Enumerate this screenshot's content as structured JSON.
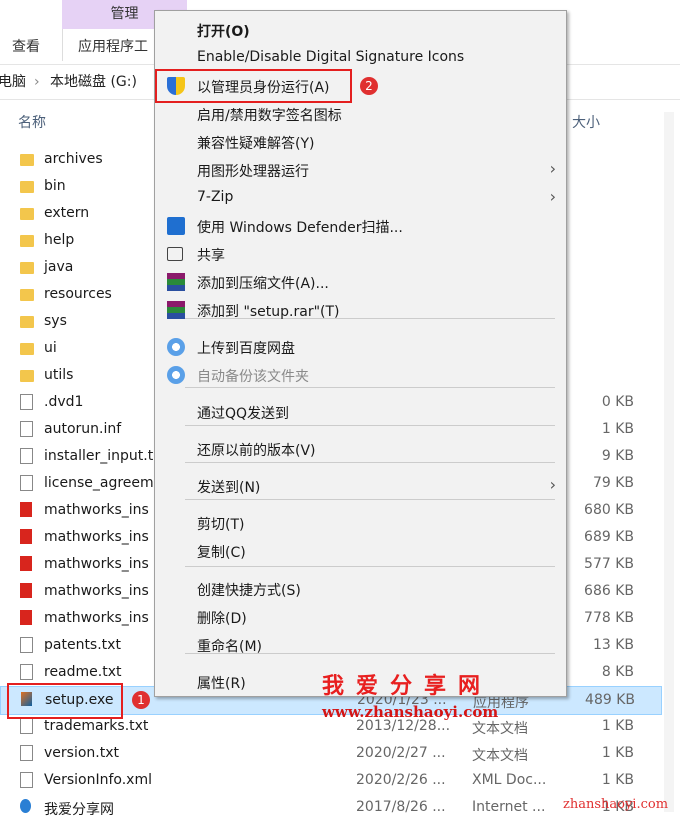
{
  "ribbon": {
    "context_tab": "管理",
    "tabs": [
      "查看",
      "应用程序工"
    ]
  },
  "address": {
    "crumbs": [
      "电脑",
      "本地磁盘 (G:)"
    ]
  },
  "columns": {
    "name": "名称",
    "size": "大小"
  },
  "files": [
    {
      "name": "archives",
      "type": "folder"
    },
    {
      "name": "bin",
      "type": "folder"
    },
    {
      "name": "extern",
      "type": "folder"
    },
    {
      "name": "help",
      "type": "folder"
    },
    {
      "name": "java",
      "type": "folder"
    },
    {
      "name": "resources",
      "type": "folder"
    },
    {
      "name": "sys",
      "type": "folder"
    },
    {
      "name": "ui",
      "type": "folder"
    },
    {
      "name": "utils",
      "type": "folder"
    },
    {
      "name": ".dvd1",
      "type": "file",
      "size": "0 KB"
    },
    {
      "name": "autorun.inf",
      "type": "file",
      "size": "1 KB"
    },
    {
      "name": "installer_input.t",
      "type": "file",
      "size": "9 KB"
    },
    {
      "name": "license_agreem",
      "type": "file",
      "size": "79 KB"
    },
    {
      "name": "mathworks_ins",
      "type": "pdf",
      "size": "680 KB"
    },
    {
      "name": "mathworks_ins",
      "type": "pdf",
      "size": "689 KB"
    },
    {
      "name": "mathworks_ins",
      "type": "pdf",
      "size": "577 KB"
    },
    {
      "name": "mathworks_ins",
      "type": "pdf",
      "size": "686 KB"
    },
    {
      "name": "mathworks_ins",
      "type": "pdf",
      "size": "778 KB"
    },
    {
      "name": "patents.txt",
      "type": "file",
      "size": "13 KB"
    },
    {
      "name": "readme.txt",
      "type": "file",
      "size": "8 KB"
    },
    {
      "name": "setup.exe",
      "type": "exe",
      "date": "2020/1/23 ...",
      "kind": "应用程序",
      "size": "489 KB",
      "selected": true
    },
    {
      "name": "trademarks.txt",
      "type": "file",
      "date": "2013/12/28...",
      "kind": "文本文档",
      "size": "1 KB"
    },
    {
      "name": "version.txt",
      "type": "file",
      "date": "2020/2/27 ...",
      "kind": "文本文档",
      "size": "1 KB"
    },
    {
      "name": "VersionInfo.xml",
      "type": "file",
      "date": "2020/2/26 ...",
      "kind": "XML Doc...",
      "size": "1 KB"
    },
    {
      "name": "我爱分享网",
      "type": "url",
      "date": "2017/8/26 ...",
      "kind": "Internet ...",
      "size": "1 KB"
    }
  ],
  "menu": [
    {
      "label": "打开(O)",
      "bold": true
    },
    {
      "label": "Enable/Disable Digital Signature Icons"
    },
    {
      "label": "以管理员身份运行(A)",
      "icon": "uac-shield-icon",
      "highlight": true
    },
    {
      "label": "启用/禁用数字签名图标"
    },
    {
      "label": "兼容性疑难解答(Y)"
    },
    {
      "label": "用图形处理器运行",
      "submenu": true
    },
    {
      "label": "7-Zip",
      "submenu": true
    },
    {
      "label": "使用 Windows Defender扫描...",
      "icon": "defender-icon"
    },
    {
      "label": "共享",
      "icon": "share-icon"
    },
    {
      "label": "添加到压缩文件(A)...",
      "icon": "winrar-icon"
    },
    {
      "label": "添加到 \"setup.rar\"(T)",
      "icon": "winrar-icon"
    },
    {
      "label": "上传到百度网盘",
      "icon": "baidu-icon"
    },
    {
      "label": "自动备份该文件夹",
      "icon": "baidu-icon",
      "disabled": true
    },
    {
      "label": "通过QQ发送到"
    },
    {
      "label": "还原以前的版本(V)"
    },
    {
      "label": "发送到(N)",
      "submenu": true
    },
    {
      "label": "剪切(T)"
    },
    {
      "label": "复制(C)"
    },
    {
      "label": "创建快捷方式(S)"
    },
    {
      "label": "删除(D)"
    },
    {
      "label": "重命名(M)"
    },
    {
      "label": "属性(R)"
    }
  ],
  "badges": [
    "1",
    "2"
  ],
  "watermark": {
    "title": "我爱分享网",
    "url": "www.zhanshaoyi.com",
    "corner": "zhanshaoyi.com"
  },
  "colors": {
    "highlight": "#e41f1f",
    "selection": "#cce8ff",
    "context_tab": "#e6d2f5"
  }
}
